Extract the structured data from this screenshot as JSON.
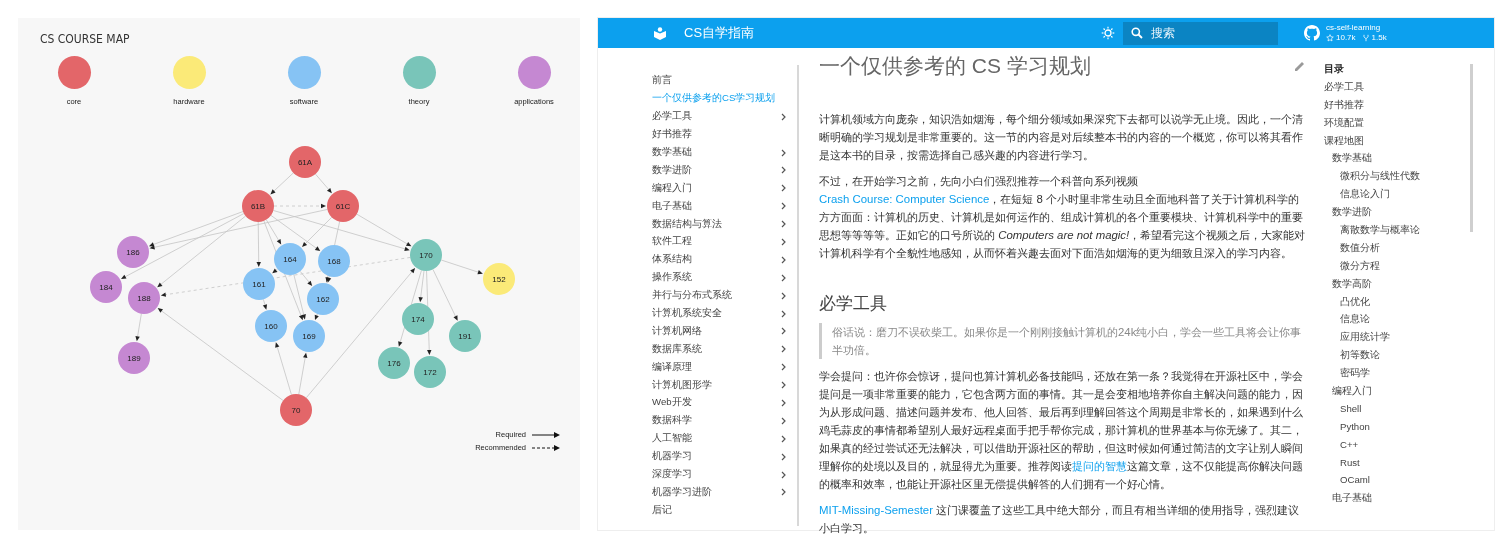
{
  "course_map": {
    "title": "CS COURSE MAP",
    "categories": [
      {
        "name": "core",
        "color": "#e36669"
      },
      {
        "name": "hardware",
        "color": "#fbea78"
      },
      {
        "name": "software",
        "color": "#86c3f4"
      },
      {
        "name": "theory",
        "color": "#79c5b9"
      },
      {
        "name": "applications",
        "color": "#c588d2"
      }
    ],
    "nodes": [
      {
        "label": "61A",
        "color": "#e36669"
      },
      {
        "label": "61B",
        "color": "#e36669"
      },
      {
        "label": "61C",
        "color": "#e36669"
      },
      {
        "label": "186",
        "color": "#c588d2"
      },
      {
        "label": "184",
        "color": "#c588d2"
      },
      {
        "label": "188",
        "color": "#c588d2"
      },
      {
        "label": "189",
        "color": "#c588d2"
      },
      {
        "label": "164",
        "color": "#86c3f4"
      },
      {
        "label": "168",
        "color": "#86c3f4"
      },
      {
        "label": "161",
        "color": "#86c3f4"
      },
      {
        "label": "162",
        "color": "#86c3f4"
      },
      {
        "label": "160",
        "color": "#86c3f4"
      },
      {
        "label": "169",
        "color": "#86c3f4"
      },
      {
        "label": "170",
        "color": "#79c5b9"
      },
      {
        "label": "152",
        "color": "#fbea78"
      },
      {
        "label": "174",
        "color": "#79c5b9"
      },
      {
        "label": "191",
        "color": "#79c5b9"
      },
      {
        "label": "176",
        "color": "#79c5b9"
      },
      {
        "label": "172",
        "color": "#79c5b9"
      },
      {
        "label": "70",
        "color": "#e36669"
      }
    ],
    "key": [
      {
        "label": "Required",
        "kind": "solid"
      },
      {
        "label": "Recommended",
        "kind": "dashed"
      }
    ]
  },
  "guide": {
    "header": {
      "title": "CS自学指南",
      "search": {
        "placeholder": "搜索"
      },
      "repo": {
        "name": "cs-self-learning",
        "star_count": "10.7k",
        "fork_count": "1.5k"
      }
    },
    "nav": [
      {
        "label": "前言",
        "kind": "page",
        "selected": false
      },
      {
        "label": "一个仅供参考的CS学习规划",
        "kind": "page",
        "selected": true
      },
      {
        "label": "必学工具",
        "kind": "section",
        "selected": false
      },
      {
        "label": "好书推荐",
        "kind": "page",
        "selected": false
      },
      {
        "label": "数学基础",
        "kind": "section",
        "selected": false
      },
      {
        "label": "数学进阶",
        "kind": "section",
        "selected": false
      },
      {
        "label": "编程入门",
        "kind": "section",
        "selected": false
      },
      {
        "label": "电子基础",
        "kind": "section",
        "selected": false
      },
      {
        "label": "数据结构与算法",
        "kind": "section",
        "selected": false
      },
      {
        "label": "软件工程",
        "kind": "section",
        "selected": false
      },
      {
        "label": "体系结构",
        "kind": "section",
        "selected": false
      },
      {
        "label": "操作系统",
        "kind": "section",
        "selected": false
      },
      {
        "label": "并行与分布式系统",
        "kind": "section",
        "selected": false
      },
      {
        "label": "计算机系统安全",
        "kind": "section",
        "selected": false
      },
      {
        "label": "计算机网络",
        "kind": "section",
        "selected": false
      },
      {
        "label": "数据库系统",
        "kind": "section",
        "selected": false
      },
      {
        "label": "编译原理",
        "kind": "section",
        "selected": false
      },
      {
        "label": "计算机图形学",
        "kind": "section",
        "selected": false
      },
      {
        "label": "Web开发",
        "kind": "section",
        "selected": false
      },
      {
        "label": "数据科学",
        "kind": "section",
        "selected": false
      },
      {
        "label": "人工智能",
        "kind": "section",
        "selected": false
      },
      {
        "label": "机器学习",
        "kind": "section",
        "selected": false
      },
      {
        "label": "深度学习",
        "kind": "section",
        "selected": false
      },
      {
        "label": "机器学习进阶",
        "kind": "section",
        "selected": false
      },
      {
        "label": "后记",
        "kind": "page",
        "selected": false
      }
    ],
    "article": {
      "title": "一个仅供参考的 CS 学习规划",
      "blocks": [
        {
          "kind": "paragraph",
          "segments": [
            {
              "kind": "text",
              "text": "计算机领域方向庞杂，知识浩如烟海，每个细分领域如果深究下去都可以说学无止境。因此，一个清晰明确的学习规划是非常重要的。这一节的内容是对后续整本书的内容的一个概览，你可以将其看作是这本书的目录，按需选择自己感兴趣的内容进行学习。"
            }
          ]
        },
        {
          "kind": "paragraph",
          "segments": [
            {
              "kind": "text",
              "text": "不过，在开始学习之前，先向小白们强烈推荐一个科普向系列视频 "
            },
            {
              "kind": "link",
              "text": "Crash Course: Computer Science"
            },
            {
              "kind": "text",
              "text": "，在短短 8 个小时里非常生动且全面地科普了关于计算机科学的方方面面：计算机的历史、计算机是如何运作的、组成计算机的各个重要模块、计算机科学中的重要思想等等等等。正如它的口号所说的 *Computers are not magic!*，希望看完这个视频之后，大家能对计算机科学有个全貌性地感知，从而怀着兴趣去面对下面浩如烟海的更为细致且深入的学习内容。"
            }
          ]
        },
        {
          "kind": "heading",
          "text": "必学工具"
        },
        {
          "kind": "quote",
          "text": "俗话说：磨刀不误砍柴工。如果你是一个刚刚接触计算机的24k纯小白，学会一些工具将会让你事半功倍。"
        },
        {
          "kind": "paragraph",
          "segments": [
            {
              "kind": "text",
              "text": "学会提问：也许你会惊讶，提问也算计算机必备技能吗，还放在第一条？我觉得在开源社区中，学会提问是一项非常重要的能力，它包含两方面的事情。其一是会变相地培养你自主解决问题的能力，因为从形成问题、描述问题并发布、他人回答、最后再到理解回答这个周期是非常长的，如果遇到什么鸡毛蒜皮的事情都希望别人最好远程桌面手把手帮你完成，那计算机的世界基本与你无缘了。其二，如果真的经过尝试还无法解决，可以借助开源社区的帮助，但这时候如何通过简洁的文字让别人瞬间理解你的处境以及目的，就显得尤为重要。推荐阅读"
            },
            {
              "kind": "link",
              "text": "提问的智慧"
            },
            {
              "kind": "text",
              "text": "这篇文章，这不仅能提高你解决问题的概率和效率，也能让开源社区里无偿提供解答的人们拥有一个好心情。"
            }
          ]
        },
        {
          "kind": "paragraph",
          "segments": [
            {
              "kind": "link",
              "text": "MIT-Missing-Semester"
            },
            {
              "kind": "text",
              "text": " 这门课覆盖了这些工具中绝大部分，而且有相当详细的使用指导，强烈建议小白学习。"
            }
          ]
        }
      ]
    },
    "toc": {
      "title": "目录",
      "items": [
        {
          "label": "必学工具"
        },
        {
          "label": "好书推荐"
        },
        {
          "label": "环境配置"
        },
        {
          "label": "课程地图",
          "children": [
            {
              "label": "数学基础",
              "children": [
                {
                  "label": "微积分与线性代数"
                },
                {
                  "label": "信息论入门"
                }
              ]
            },
            {
              "label": "数学进阶",
              "children": [
                {
                  "label": "离散数学与概率论"
                },
                {
                  "label": "数值分析"
                },
                {
                  "label": "微分方程"
                }
              ]
            },
            {
              "label": "数学高阶",
              "children": [
                {
                  "label": "凸优化"
                },
                {
                  "label": "信息论"
                },
                {
                  "label": "应用统计学"
                },
                {
                  "label": "初等数论"
                },
                {
                  "label": "密码学"
                }
              ]
            },
            {
              "label": "编程入门",
              "children": [
                {
                  "label": "Shell"
                },
                {
                  "label": "Python"
                },
                {
                  "label": "C++"
                },
                {
                  "label": "Rust"
                },
                {
                  "label": "OCaml"
                }
              ]
            },
            {
              "label": "电子基础"
            }
          ]
        }
      ]
    }
  }
}
